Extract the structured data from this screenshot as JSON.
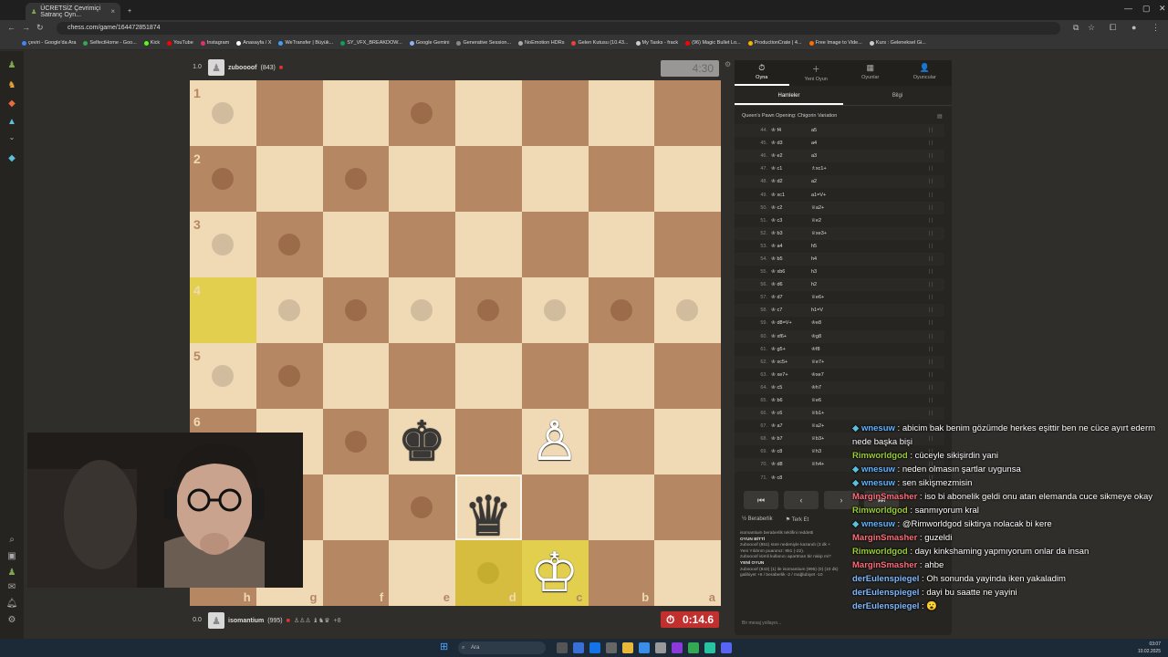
{
  "browser": {
    "tab_title": "ÜCRETSİZ Çevrimiçi Satranç Oyn...",
    "new_tab_symbol": "+",
    "close_symbol": "×",
    "url": "chess.com/game/164472851874",
    "bookmarks": [
      {
        "label": "çeviri - Google'da Ara",
        "color": "#4285f4"
      },
      {
        "label": "SelfectHome - Goo...",
        "color": "#34a853"
      },
      {
        "label": "Kick",
        "color": "#53fc18"
      },
      {
        "label": "YouTube",
        "color": "#ff0000"
      },
      {
        "label": "Instagram",
        "color": "#e1306c"
      },
      {
        "label": "Anasayfa / X",
        "color": "#ffffff"
      },
      {
        "label": "WeTransfer | Büyük...",
        "color": "#409fff"
      },
      {
        "label": "SY_VFX_BREAKDOW...",
        "color": "#0f9d58"
      },
      {
        "label": "Google Gemini",
        "color": "#8ab4f8"
      },
      {
        "label": "Generative Session...",
        "color": "#888888"
      },
      {
        "label": "NoEmotion HDRs",
        "color": "#aaaaaa"
      },
      {
        "label": "Gelen Kutusu (10.43...",
        "color": "#ea4335"
      },
      {
        "label": "My Tasks - frack",
        "color": "#cccccc"
      },
      {
        "label": "(96) Magic Bullet Lo...",
        "color": "#ff0000"
      },
      {
        "label": "ProductionCrate | 4...",
        "color": "#f4b400"
      },
      {
        "label": "Free Image to Vide...",
        "color": "#ff6d00"
      },
      {
        "label": "Kurs : Geleneksel Gi...",
        "color": "#cccccc"
      }
    ]
  },
  "top_player": {
    "rating_box": "1.0",
    "name": "zuboooof",
    "rating": "(843)",
    "clock": "4:30"
  },
  "bottom_player": {
    "rating_box": "0.0",
    "name": "isomantium",
    "rating": "(995)",
    "material": "+8",
    "clock": "0:14.6"
  },
  "board": {
    "ranks": [
      "1",
      "2",
      "3",
      "4",
      "5",
      "6"
    ],
    "files": [
      "h",
      "g",
      "f",
      "e",
      "d",
      "c",
      "b",
      "a"
    ],
    "pieces": {
      "black_king": "♚",
      "black_queen": "♛",
      "white_pawn": "♙",
      "white_king": "♔"
    }
  },
  "panel": {
    "tabs": [
      {
        "label": "Oyna",
        "icon": "⏱"
      },
      {
        "label": "Yeni Oyun",
        "icon": "＋"
      },
      {
        "label": "Oyunlar",
        "icon": "▦"
      },
      {
        "label": "Oyuncular",
        "icon": "👤"
      }
    ],
    "subtabs": [
      "Hamleler",
      "Bilgi"
    ],
    "opening": "Queen's Pawn Opening: Chigorin Variation",
    "moves": [
      {
        "n": "44.",
        "w": "f4",
        "b": "a5"
      },
      {
        "n": "45.",
        "w": "d3",
        "b": "a4"
      },
      {
        "n": "46.",
        "w": "e2",
        "b": "a3"
      },
      {
        "n": "47.",
        "w": "c1",
        "b": "♗xc1+"
      },
      {
        "n": "48.",
        "w": "d2",
        "b": "a2"
      },
      {
        "n": "49.",
        "w": "xc1",
        "b": "a1=V+"
      },
      {
        "n": "50.",
        "w": "c2",
        "b": "♕a2+"
      },
      {
        "n": "51.",
        "w": "c3",
        "b": "♕e2"
      },
      {
        "n": "52.",
        "w": "b3",
        "b": "♕xe3+"
      },
      {
        "n": "53.",
        "w": "a4",
        "b": "h5"
      },
      {
        "n": "54.",
        "w": "b5",
        "b": "h4"
      },
      {
        "n": "55.",
        "w": "xb6",
        "b": "h3"
      },
      {
        "n": "56.",
        "w": "d6",
        "b": "h2"
      },
      {
        "n": "57.",
        "w": "d7",
        "b": "♕e6+"
      },
      {
        "n": "58.",
        "w": "c7",
        "b": "h1=V"
      },
      {
        "n": "59.",
        "w": "d8=V+",
        "b": "♔e8"
      },
      {
        "n": "60.",
        "w": "xf6+",
        "b": "♔g8"
      },
      {
        "n": "61.",
        "w": "g5+",
        "b": "♔f8"
      },
      {
        "n": "62.",
        "w": "xc5+",
        "b": "♕e7+"
      },
      {
        "n": "63.",
        "w": "xe7+",
        "b": "♔xe7"
      },
      {
        "n": "64.",
        "w": "c5",
        "b": "♔h7"
      },
      {
        "n": "65.",
        "w": "b6",
        "b": "♕e6"
      },
      {
        "n": "66.",
        "w": "c6",
        "b": "♕b1+"
      },
      {
        "n": "67.",
        "w": "a7",
        "b": "♕a2+"
      },
      {
        "n": "68.",
        "w": "b7",
        "b": "♕b3+"
      },
      {
        "n": "69.",
        "w": "c8",
        "b": "♕h3"
      },
      {
        "n": "70.",
        "w": "d8",
        "b": "♕h4+"
      },
      {
        "n": "71.",
        "w": "c8",
        "b": ""
      }
    ],
    "nav": [
      "⏮",
      "‹",
      "›",
      "⏭"
    ],
    "draw_label": "Beraberlik",
    "resign_label": "Terk Et",
    "log": [
      {
        "t": "isomantium beraberlik teklifini reddetti",
        "bold": false
      },
      {
        "t": "OYUN BİTTİ",
        "bold": true
      },
      {
        "t": "zuboooof (851) süre nedeniyle kazandı (3 dk +",
        "bold": false
      },
      {
        "t": "Yeni Yıldırım puanınız: 851 (-22).",
        "bold": false
      },
      {
        "t": "zuboooof isimli kullanıcı apartman bir rakip mi?",
        "bold": false
      },
      {
        "t": "YENİ OYUN",
        "bold": true
      },
      {
        "t": "zuboooof (843) (1) ile isomantium (995) (0) (10 dk)",
        "bold": false
      },
      {
        "t": "galibiyet +6 / beraberlik -2 / mağlubiyet -10",
        "bold": false
      }
    ],
    "msg_placeholder": "Bir mesaj yollayın..."
  },
  "chat": [
    {
      "user": "wnesuw",
      "color": "#5fb3ff",
      "badge": true,
      "text": "abicim bak benim gözümde herkes eşittir ben ne cüce ayırt ederm nede başka bişi"
    },
    {
      "user": "Rimworldgod",
      "color": "#9acd32",
      "badge": false,
      "text": "cüceyle sikişirdin yani"
    },
    {
      "user": "wnesuw",
      "color": "#5fb3ff",
      "badge": true,
      "text": "neden olmasın şartlar uygunsa"
    },
    {
      "user": "wnesuw",
      "color": "#5fb3ff",
      "badge": true,
      "text": "sen sikişmezmisin"
    },
    {
      "user": "MarginSmasher",
      "color": "#ff6b7a",
      "badge": false,
      "text": "iso bi abonelik geldi onu atan elemanda cuce sikmeye okay"
    },
    {
      "user": "Rimworldgod",
      "color": "#9acd32",
      "badge": false,
      "text": "sanmıyorum kral"
    },
    {
      "user": "wnesuw",
      "color": "#5fb3ff",
      "badge": true,
      "text": "@Rimworldgod siktirya nolacak bi kere"
    },
    {
      "user": "MarginSmasher",
      "color": "#ff6b7a",
      "badge": false,
      "text": "guzeldi"
    },
    {
      "user": "Rimworldgod",
      "color": "#9acd32",
      "badge": false,
      "text": "dayı kinkshaming yapmıyorum onlar da insan"
    },
    {
      "user": "MarginSmasher",
      "color": "#ff6b7a",
      "badge": false,
      "text": "ahbe"
    },
    {
      "user": "derEulenspiegel",
      "color": "#7fb8ff",
      "badge": false,
      "text": "Oh sonunda yayinda iken yakaladim"
    },
    {
      "user": "derEulenspiegel",
      "color": "#7fb8ff",
      "badge": false,
      "text": "dayi bu saatte ne yayini"
    },
    {
      "user": "derEulenspiegel",
      "color": "#7fb8ff",
      "badge": false,
      "text": "😮"
    }
  ],
  "taskbar": {
    "search": "Ara",
    "time": "03:07",
    "date": "10.02.2025"
  },
  "colors": {
    "light_square": "#f0d9b5",
    "dark_square": "#b58863",
    "highlight": "#e2cf4e",
    "clock_low": "#c12f2f"
  }
}
